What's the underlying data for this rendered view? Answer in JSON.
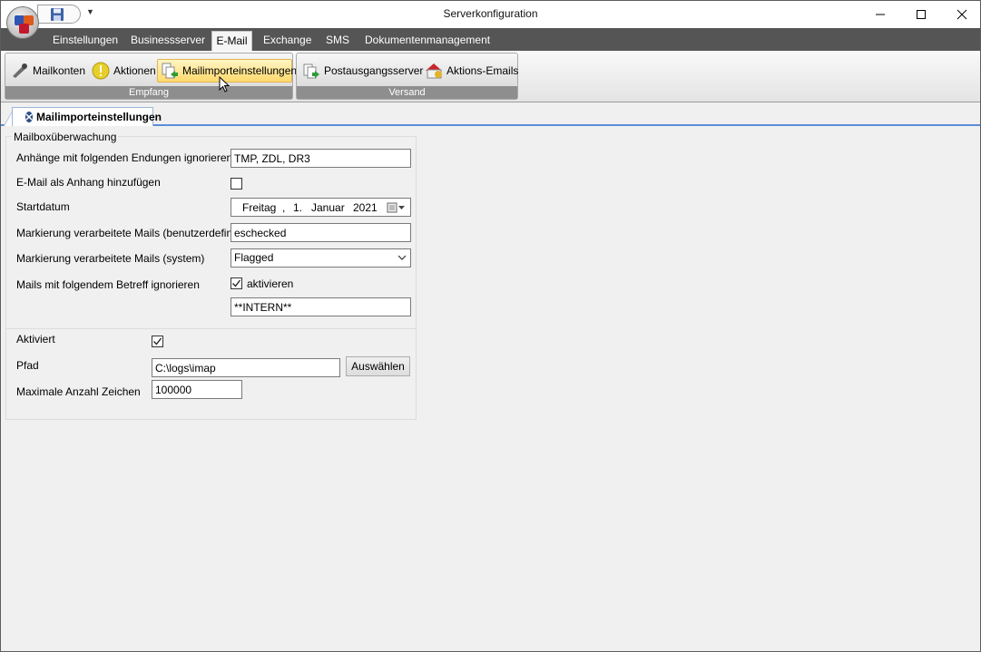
{
  "window": {
    "title": "Serverkonfiguration",
    "controls": [
      "minimize",
      "maximize",
      "close"
    ]
  },
  "quick_access": {
    "icons": [
      "save-icon",
      "qat-dropdown-icon"
    ]
  },
  "ribbon_tabs": [
    {
      "label": "Einstellungen"
    },
    {
      "label": "Businessserver"
    },
    {
      "label": "E-Mail",
      "selected": true
    },
    {
      "label": "Exchange"
    },
    {
      "label": "SMS"
    },
    {
      "label": "Dokumentenmanagement"
    }
  ],
  "ribbon": {
    "groups": [
      {
        "label": "Empfang",
        "buttons": [
          {
            "label": "Mailkonten",
            "icon": "mail-accounts-icon"
          },
          {
            "label": "Aktionen",
            "icon": "warning-icon"
          },
          {
            "label": "Mailimporteinstellungen",
            "icon": "mail-import-icon",
            "active": true
          }
        ]
      },
      {
        "label": "Versand",
        "buttons": [
          {
            "label": "Postausgangsserver",
            "icon": "outgoing-server-icon"
          },
          {
            "label": "Aktions-Emails",
            "icon": "action-mail-icon"
          }
        ]
      }
    ]
  },
  "doc_tab": {
    "label": "Mailimporteinstellungen"
  },
  "form": {
    "groupbox_title": "Mailboxüberwachung",
    "fields": {
      "ignore_extensions": {
        "label": "Anhänge mit folgenden Endungen ignorieren",
        "value": "TMP, ZDL, DR3"
      },
      "attach_email": {
        "label": "E-Mail als Anhang hinzufügen",
        "checked": false
      },
      "start_date": {
        "label": "Startdatum",
        "weekday": "Freitag",
        "sep": ",",
        "day": "1.",
        "month": "Januar",
        "year": "2021"
      },
      "mark_custom": {
        "label": "Markierung verarbeitete Mails (benutzerdefiniert)",
        "value": "eschecked"
      },
      "mark_system": {
        "label": "Markierung verarbeitete Mails (system)",
        "value": "Flagged"
      },
      "ignore_subject": {
        "label": "Mails mit folgendem Betreff ignorieren",
        "checkbox_label": "aktivieren",
        "checked": true,
        "value": "**INTERN**"
      }
    },
    "log": {
      "enabled": {
        "label": "Aktiviert",
        "checked": true
      },
      "path": {
        "label": "Pfad",
        "value": "C:\\logs\\imap",
        "button": "Auswählen"
      },
      "max_chars": {
        "label": "Maximale Anzahl Zeichen",
        "value": "100000"
      }
    }
  },
  "colors": {
    "tab_row": "#555555",
    "group_label": "#8e8e8e",
    "active_button": "#ffd96c",
    "doc_tab_accent": "#5a8fd6"
  }
}
